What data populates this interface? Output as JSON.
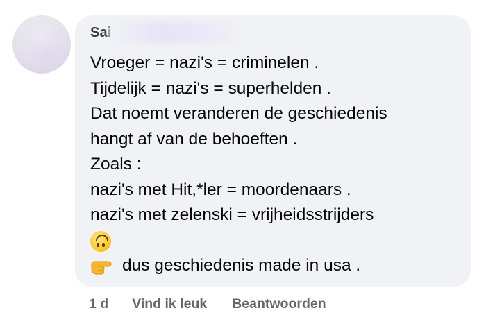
{
  "comment": {
    "author": "Sai",
    "lines": [
      "Vroeger = nazi's = criminelen .",
      "Tijdelijk = nazi's = superhelden .",
      "Dat noemt veranderen de geschiedenis",
      "hangt af van de behoeften .",
      "Zoals :",
      "nazi's met Hit,*ler = moordenaars .",
      "nazi's met zelenski = vrijheidsstrijders"
    ],
    "emoji_line_icon": "upside-down-face-emoji",
    "last_line_icon": "pointing-right-emoji",
    "last_line_text": "dus geschiedenis made in usa ."
  },
  "actions": {
    "time": "1 d",
    "like_label": "Vind ik leuk",
    "reply_label": "Beantwoorden"
  },
  "colors": {
    "bubble": "#f0f2f5",
    "text": "#050505",
    "meta": "#65676b"
  }
}
